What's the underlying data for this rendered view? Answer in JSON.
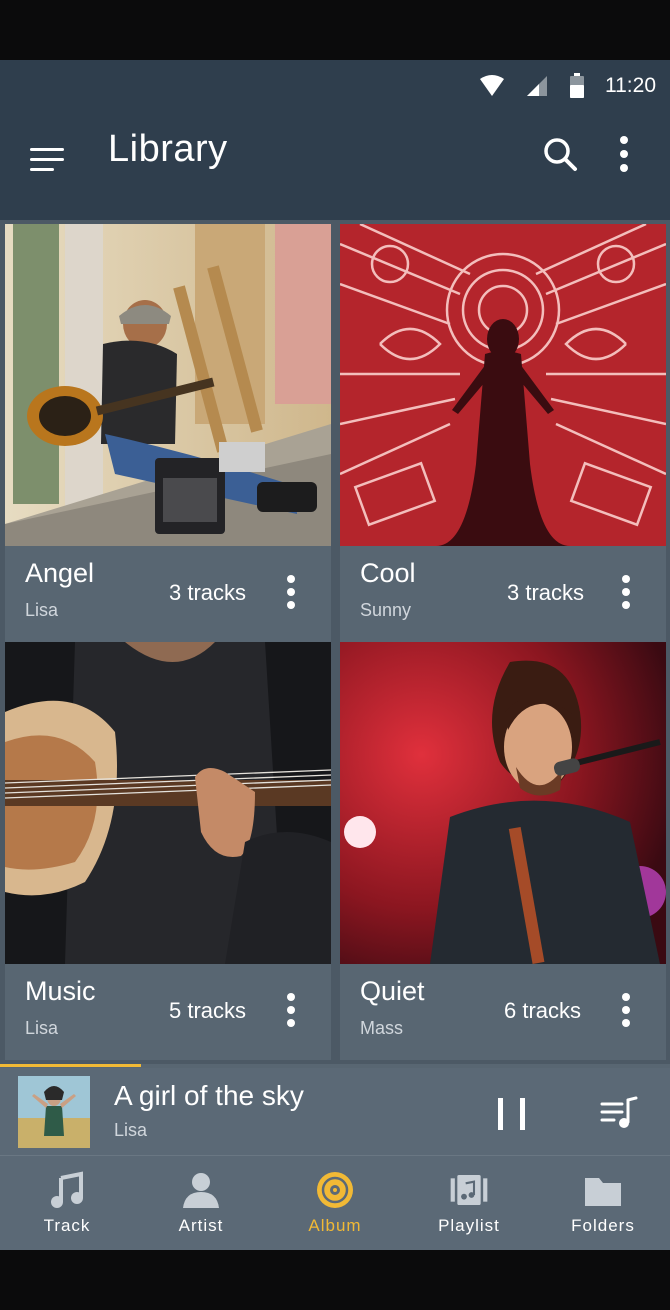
{
  "status_bar": {
    "time": "11:20",
    "icons": [
      "wifi-icon",
      "signal-icon",
      "battery-icon"
    ]
  },
  "app_bar": {
    "title": "Library",
    "icons": [
      "menu-icon",
      "search-icon",
      "more-vert-icon"
    ]
  },
  "albums": [
    {
      "name": "Angel",
      "artist": "Lisa",
      "tracks": "3 tracks",
      "art": "street guitarist photo"
    },
    {
      "name": "Cool",
      "artist": "Sunny",
      "tracks": "3 tracks",
      "art": "red neon singer art"
    },
    {
      "name": "Music",
      "artist": "Lisa",
      "tracks": "5 tracks",
      "art": "acoustic guitar close-up"
    },
    {
      "name": "Quiet",
      "artist": "Mass",
      "tracks": "6 tracks",
      "art": "singer at microphone on stage"
    }
  ],
  "now_playing": {
    "title": "A girl of the sky",
    "artist": "Lisa",
    "progress": 0.21
  },
  "bottom_nav": [
    {
      "label": "Track",
      "icon": "music-note-icon",
      "active": false
    },
    {
      "label": "Artist",
      "icon": "person-icon",
      "active": false
    },
    {
      "label": "Album",
      "icon": "disc-icon",
      "active": true
    },
    {
      "label": "Playlist",
      "icon": "playlist-icon",
      "active": false
    },
    {
      "label": "Folders",
      "icon": "folder-icon",
      "active": false
    }
  ],
  "colors": {
    "accent": "#f1b935",
    "app_bar": "#2f3e4d",
    "surface": "#586672"
  }
}
